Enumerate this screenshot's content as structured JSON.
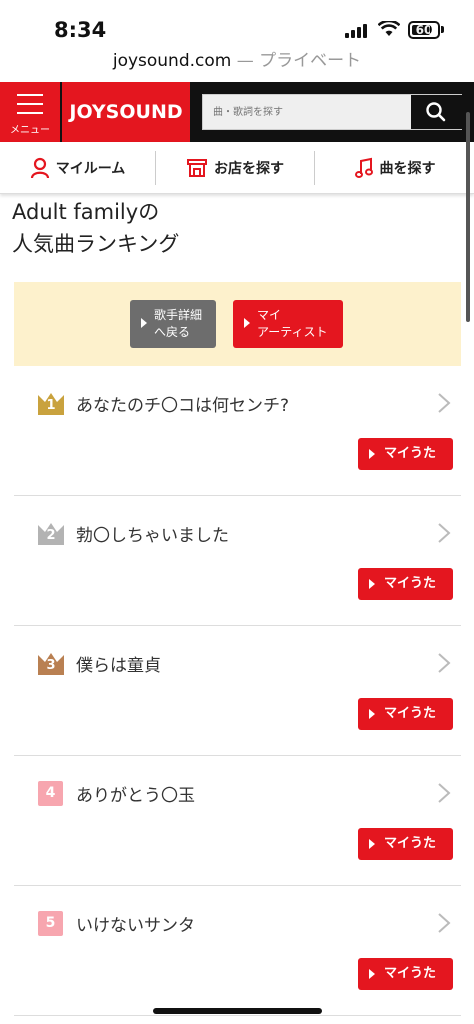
{
  "status": {
    "time": "8:34",
    "battery": "60"
  },
  "browser": {
    "domain": "joysound.com",
    "private_label": "— プライベート"
  },
  "header": {
    "menu_label": "メニュー",
    "logo_text": "JOYSOUND",
    "search_placeholder": "曲・歌詞を探す",
    "icons": {
      "menu": "hamburger-icon",
      "search": "search-icon"
    }
  },
  "nav": {
    "items": [
      {
        "label": "マイルーム",
        "icon": "person-icon"
      },
      {
        "label": "お店を探す",
        "icon": "store-icon"
      },
      {
        "label": "曲を探す",
        "icon": "music-note-icon"
      }
    ]
  },
  "page": {
    "title_line1": "Adult familyの",
    "title_line2": "人気曲ランキング"
  },
  "actions": {
    "back_label_line1": "歌手詳細",
    "back_label_line2": "へ戻る",
    "myartist_label_line1": "マイ",
    "myartist_label_line2": "アーティスト"
  },
  "ranking": {
    "myuta_label": "マイうた",
    "items": [
      {
        "rank": "1",
        "title": "あなたのチ〇コは何センチ?",
        "badge": "crown-gold"
      },
      {
        "rank": "2",
        "title": "勃〇しちゃいました",
        "badge": "crown-silver"
      },
      {
        "rank": "3",
        "title": "僕らは童貞",
        "badge": "crown-bronze"
      },
      {
        "rank": "4",
        "title": "ありがとう〇玉",
        "badge": "square-pink"
      },
      {
        "rank": "5",
        "title": "いけないサンタ",
        "badge": "square-pink"
      }
    ]
  },
  "colors": {
    "brand_red": "#e4161f",
    "gold": "#c9a23e",
    "silver": "#b3b3b3",
    "bronze": "#b98052",
    "pink": "#f7a6af",
    "band": "#fdf1cc"
  }
}
